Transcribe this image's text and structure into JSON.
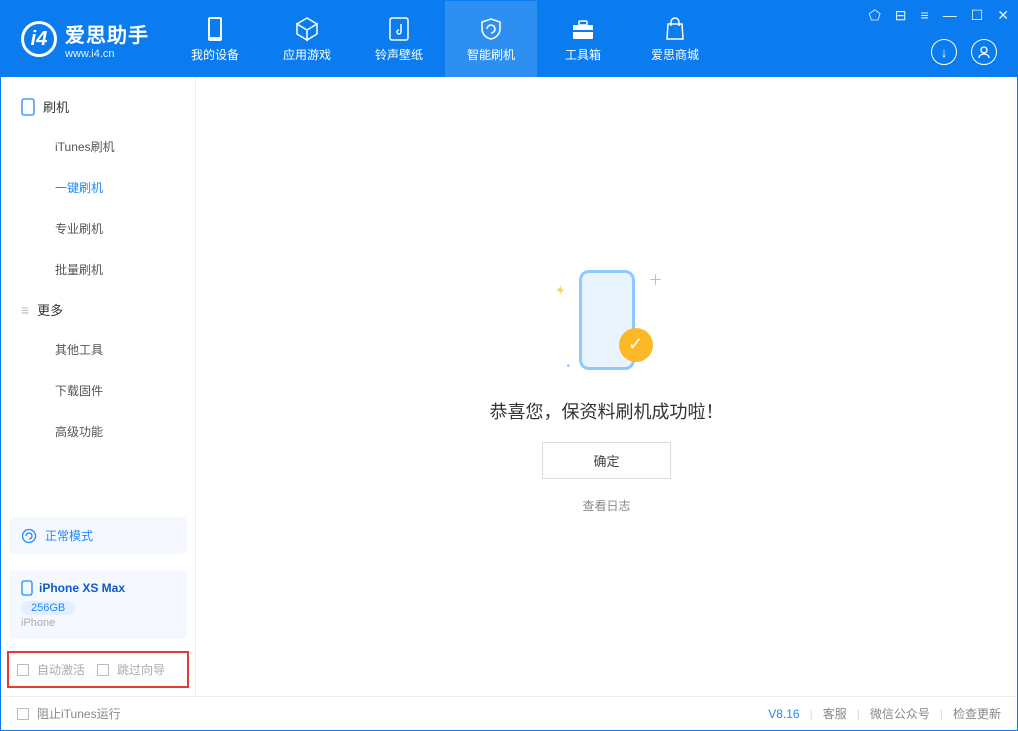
{
  "app": {
    "title": "爱思助手",
    "subtitle": "www.i4.cn"
  },
  "nav": {
    "tabs": [
      {
        "label": "我的设备"
      },
      {
        "label": "应用游戏"
      },
      {
        "label": "铃声壁纸"
      },
      {
        "label": "智能刷机"
      },
      {
        "label": "工具箱"
      },
      {
        "label": "爱思商城"
      }
    ]
  },
  "sidebar": {
    "group1": {
      "title": "刷机",
      "items": [
        "iTunes刷机",
        "一键刷机",
        "专业刷机",
        "批量刷机"
      ]
    },
    "group2": {
      "title": "更多",
      "items": [
        "其他工具",
        "下载固件",
        "高级功能"
      ]
    },
    "mode_label": "正常模式",
    "device": {
      "name": "iPhone XS Max",
      "capacity": "256GB",
      "type": "iPhone"
    },
    "opt_auto_activate": "自动激活",
    "opt_skip_guide": "跳过向导"
  },
  "content": {
    "success_text": "恭喜您，保资料刷机成功啦！",
    "ok_button": "确定",
    "view_log": "查看日志"
  },
  "footer": {
    "block_itunes": "阻止iTunes运行",
    "version": "V8.16",
    "support": "客服",
    "wechat": "微信公众号",
    "check_update": "检查更新"
  }
}
